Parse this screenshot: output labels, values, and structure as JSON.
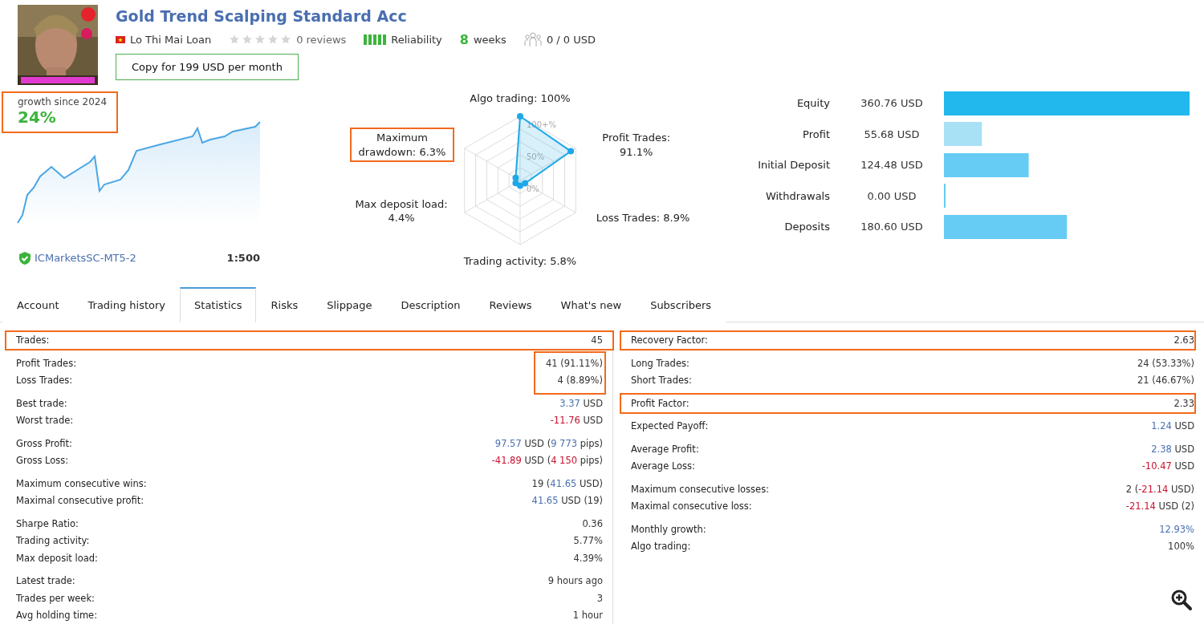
{
  "header": {
    "title": "Gold Trend Scalping Standard Acc",
    "author": "Lo Thi Mai Loan",
    "stars": 0,
    "reviews": "0 reviews",
    "reliability": {
      "label": "Reliability"
    },
    "weeks": {
      "number": "8",
      "unit": "weeks"
    },
    "subscribers": "0 / 0 USD",
    "copy_button": "Copy for 199 USD per month"
  },
  "growth": {
    "label": "growth since 2024",
    "value": "24%",
    "highlighted": true,
    "server": "ICMarketsSC-MT5-2",
    "leverage": "1:500"
  },
  "radar": {
    "top": {
      "text": "Algo trading: 100%",
      "highlighted": false
    },
    "upper_left": {
      "text": "Maximum drawdown: 6.3%",
      "highlighted": true
    },
    "upper_right": {
      "text": "Profit Trades: 91.1%",
      "highlighted": false
    },
    "lower_left": {
      "text": "Max deposit load: 4.4%",
      "highlighted": false
    },
    "lower_right": {
      "text": "Loss Trades: 8.9%",
      "highlighted": false
    },
    "bottom": {
      "text": "Trading activity: 5.8%",
      "highlighted": false
    },
    "ticks": [
      "100+%",
      "50%",
      "0%"
    ]
  },
  "balance": {
    "chart_data": {
      "type": "bar",
      "orientation": "horizontal",
      "categories": [
        "Equity",
        "Profit",
        "Initial Deposit",
        "Withdrawals",
        "Deposits"
      ],
      "values": [
        360.76,
        55.68,
        124.48,
        0.0,
        180.6
      ],
      "value_labels": [
        "360.76 USD",
        "55.68 USD",
        "124.48 USD",
        "0.00 USD",
        "180.60 USD"
      ]
    }
  },
  "tabs": [
    {
      "label": "Account",
      "selected": false
    },
    {
      "label": "Trading history",
      "selected": false
    },
    {
      "label": "Statistics",
      "selected": true
    },
    {
      "label": "Risks",
      "selected": false
    },
    {
      "label": "Slippage",
      "selected": false
    },
    {
      "label": "Description",
      "selected": false
    },
    {
      "label": "Reviews",
      "selected": false
    },
    {
      "label": "What's new",
      "selected": false
    },
    {
      "label": "Subscribers",
      "selected": false
    }
  ],
  "statistics": {
    "left": [
      {
        "highlighted": true,
        "value_highlight": false,
        "rows": [
          {
            "label": "Trades:",
            "value": [
              {
                "text": "45"
              }
            ]
          }
        ]
      },
      {
        "highlighted": false,
        "value_highlight": true,
        "rows": [
          {
            "label": "Profit Trades:",
            "value": [
              {
                "text": "41 (91.11%)"
              }
            ]
          },
          {
            "label": "Loss Trades:",
            "value": [
              {
                "text": "4 (8.89%)"
              }
            ]
          }
        ]
      },
      {
        "highlighted": false,
        "value_highlight": false,
        "rows": [
          {
            "label": "Best trade:",
            "value": [
              {
                "text": "3.37",
                "color": "#4a6fb0"
              },
              {
                "text": " USD"
              }
            ]
          },
          {
            "label": "Worst trade:",
            "value": [
              {
                "text": "-11.76",
                "color": "#c8102e"
              },
              {
                "text": " USD"
              }
            ]
          }
        ]
      },
      {
        "highlighted": false,
        "value_highlight": false,
        "rows": [
          {
            "label": "Gross Profit:",
            "value": [
              {
                "text": "97.57",
                "color": "#4a6fb0"
              },
              {
                "text": " USD ("
              },
              {
                "text": "9 773",
                "color": "#4a6fb0"
              },
              {
                "text": " pips)"
              }
            ]
          },
          {
            "label": "Gross Loss:",
            "value": [
              {
                "text": "-41.89",
                "color": "#c8102e"
              },
              {
                "text": " USD ("
              },
              {
                "text": "4 150",
                "color": "#c8102e"
              },
              {
                "text": " pips)"
              }
            ]
          }
        ]
      },
      {
        "highlighted": false,
        "value_highlight": false,
        "rows": [
          {
            "label": "Maximum consecutive wins:",
            "value": [
              {
                "text": "19 ("
              },
              {
                "text": "41.65",
                "color": "#4a6fb0"
              },
              {
                "text": " USD)"
              }
            ]
          },
          {
            "label": "Maximal consecutive profit:",
            "value": [
              {
                "text": "41.65",
                "color": "#4a6fb0"
              },
              {
                "text": " USD (19)"
              }
            ]
          }
        ]
      },
      {
        "highlighted": false,
        "value_highlight": false,
        "rows": [
          {
            "label": "Sharpe Ratio:",
            "value": [
              {
                "text": "0.36"
              }
            ]
          },
          {
            "label": "Trading activity:",
            "value": [
              {
                "text": "5.77%"
              }
            ]
          },
          {
            "label": "Max deposit load:",
            "value": [
              {
                "text": "4.39%"
              }
            ]
          }
        ]
      },
      {
        "highlighted": false,
        "value_highlight": false,
        "rows": [
          {
            "label": "Latest trade:",
            "value": [
              {
                "text": "9 hours ago"
              }
            ]
          },
          {
            "label": "Trades per week:",
            "value": [
              {
                "text": "3"
              }
            ]
          },
          {
            "label": "Avg holding time:",
            "value": [
              {
                "text": "1 hour"
              }
            ]
          }
        ]
      }
    ],
    "right": [
      {
        "highlighted": true,
        "value_highlight": false,
        "rows": [
          {
            "label": "Recovery Factor:",
            "value": [
              {
                "text": "2.63"
              }
            ]
          }
        ]
      },
      {
        "highlighted": false,
        "value_highlight": false,
        "rows": [
          {
            "label": "Long Trades:",
            "value": [
              {
                "text": "24 (53.33%)"
              }
            ]
          },
          {
            "label": "Short Trades:",
            "value": [
              {
                "text": "21 (46.67%)"
              }
            ]
          }
        ]
      },
      {
        "highlighted": true,
        "value_highlight": false,
        "rows": [
          {
            "label": "Profit Factor:",
            "value": [
              {
                "text": "2.33"
              }
            ]
          }
        ]
      },
      {
        "highlighted": false,
        "value_highlight": false,
        "rows": [
          {
            "label": "Expected Payoff:",
            "value": [
              {
                "text": "1.24",
                "color": "#4a6fb0"
              },
              {
                "text": " USD"
              }
            ]
          }
        ]
      },
      {
        "highlighted": false,
        "value_highlight": false,
        "rows": [
          {
            "label": "Average Profit:",
            "value": [
              {
                "text": "2.38",
                "color": "#4a6fb0"
              },
              {
                "text": " USD"
              }
            ]
          },
          {
            "label": "Average Loss:",
            "value": [
              {
                "text": "-10.47",
                "color": "#c8102e"
              },
              {
                "text": " USD"
              }
            ]
          }
        ]
      },
      {
        "highlighted": false,
        "value_highlight": false,
        "rows": [
          {
            "label": "Maximum consecutive losses:",
            "value": [
              {
                "text": "2 ("
              },
              {
                "text": "-21.14",
                "color": "#c8102e"
              },
              {
                "text": " USD)"
              }
            ]
          },
          {
            "label": "Maximal consecutive loss:",
            "value": [
              {
                "text": "-21.14",
                "color": "#c8102e"
              },
              {
                "text": " USD (2)"
              }
            ]
          }
        ]
      },
      {
        "highlighted": false,
        "value_highlight": false,
        "rows": [
          {
            "label": "Monthly growth:",
            "value": [
              {
                "text": "12.93%",
                "color": "#4a6fb0"
              }
            ]
          },
          {
            "label": "Algo trading:",
            "value": [
              {
                "text": "100%"
              }
            ]
          }
        ]
      }
    ]
  }
}
